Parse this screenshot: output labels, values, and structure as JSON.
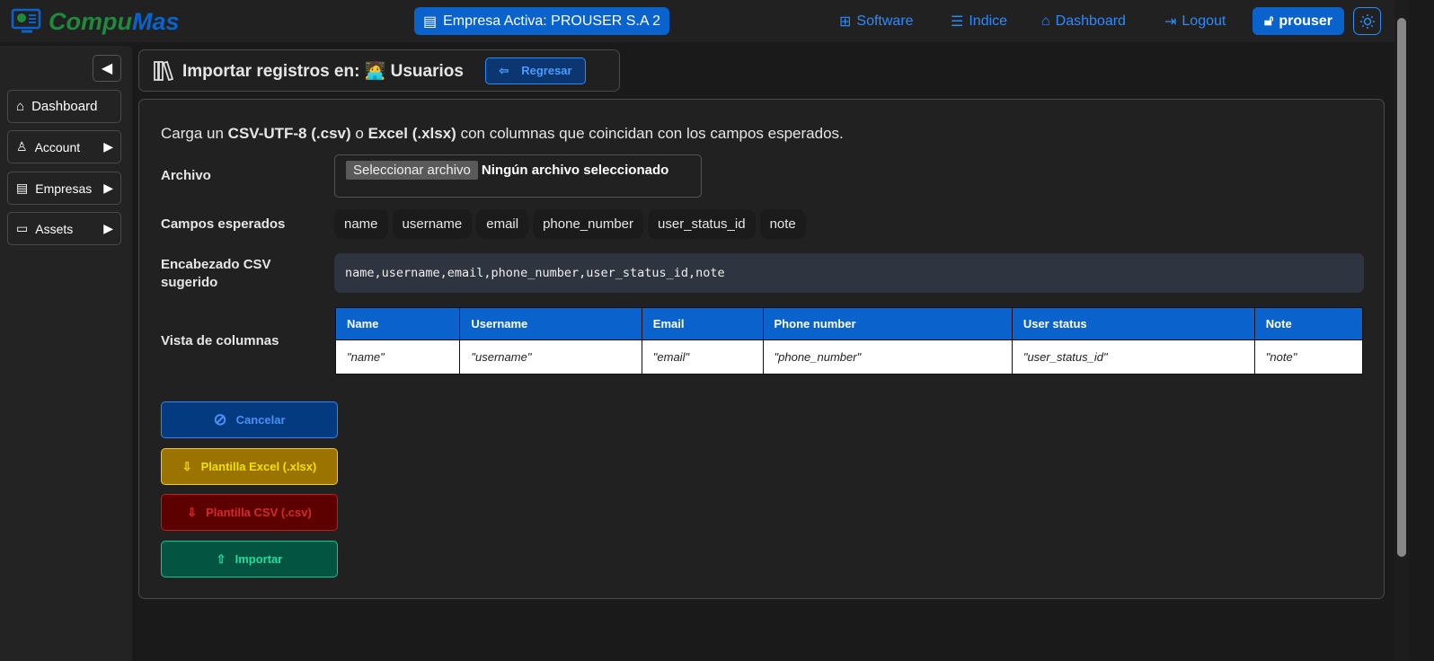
{
  "topbar": {
    "logo_part1": "Compu",
    "logo_part2": "Mas",
    "empresa": "Empresa Activa: PROUSER S.A 2",
    "nav": [
      {
        "label": "Software",
        "icon": "software-icon"
      },
      {
        "label": "Indice",
        "icon": "list-icon"
      },
      {
        "label": "Dashboard",
        "icon": "home-icon"
      },
      {
        "label": "Logout",
        "icon": "logout-icon"
      }
    ],
    "user": "prouser"
  },
  "sidebar": {
    "items": [
      {
        "label": "Dashboard"
      },
      {
        "label": "Account"
      },
      {
        "label": "Empresas"
      },
      {
        "label": "Assets"
      }
    ]
  },
  "header": {
    "title": "Importar registros en: 🧑‍💻 Usuarios",
    "back": "Regresar"
  },
  "form": {
    "intro_pre": "Carga un ",
    "intro_b1": "CSV-UTF-8 (.csv)",
    "intro_mid": " o ",
    "intro_b2": "Excel (.xlsx)",
    "intro_post": " con columnas que coincidan con los campos esperados.",
    "archivo_label": "Archivo",
    "file_button": "Seleccionar archivo",
    "file_status": "Ningún archivo seleccionado",
    "campos_label": "Campos esperados",
    "campos": [
      "name",
      "username",
      "email",
      "phone_number",
      "user_status_id",
      "note"
    ],
    "csv_label_1": "Encabezado CSV",
    "csv_label_2": "sugerido",
    "csv_header": "name,username,email,phone_number,user_status_id,note",
    "vista_label": "Vista de columnas",
    "columns": [
      "Name",
      "Username",
      "Email",
      "Phone number",
      "User status",
      "Note"
    ],
    "row": [
      "\"name\"",
      "\"username\"",
      "\"email\"",
      "\"phone_number\"",
      "\"user_status_id\"",
      "\"note\""
    ]
  },
  "actions": {
    "cancel": "Cancelar",
    "excel": "Plantilla Excel (.xlsx)",
    "csv": "Plantilla CSV (.csv)",
    "import": "Importar"
  },
  "colors": {
    "primary": "#0a63cc",
    "link": "#2a8bff"
  }
}
